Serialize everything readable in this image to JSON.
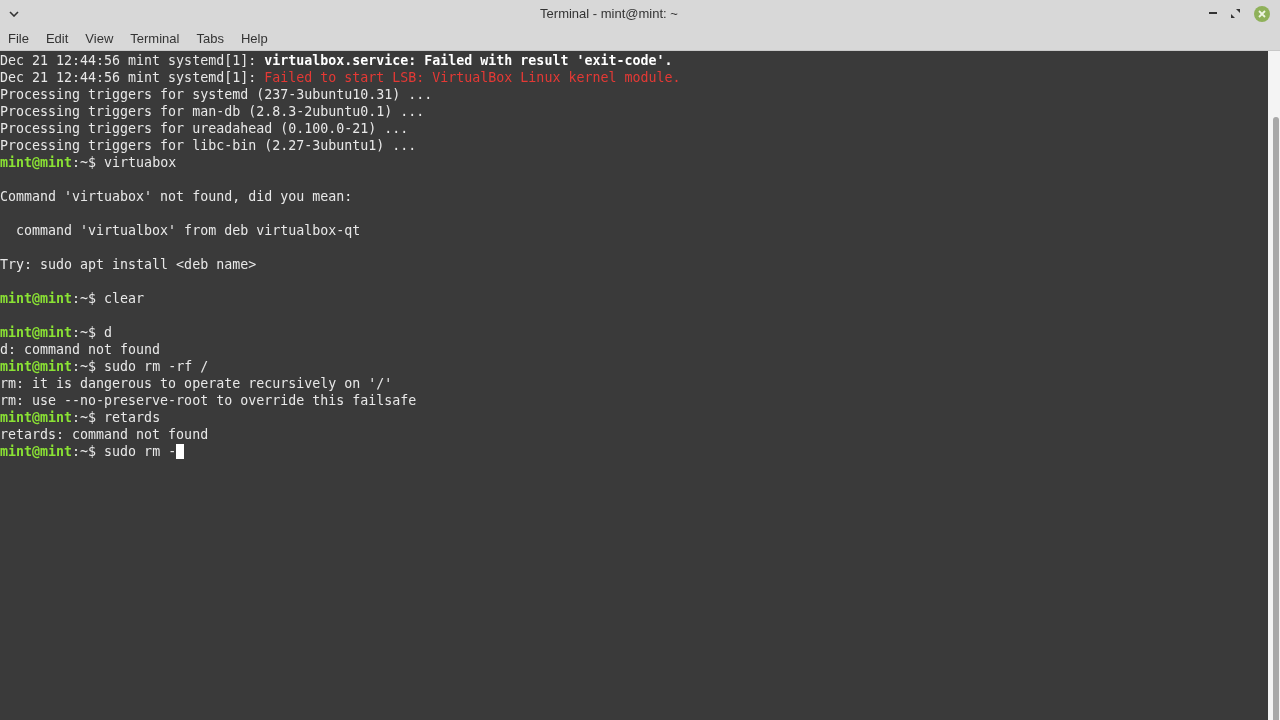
{
  "window": {
    "title": "Terminal - mint@mint: ~"
  },
  "menu": [
    "File",
    "Edit",
    "View",
    "Terminal",
    "Tabs",
    "Help"
  ],
  "lines": [
    {
      "kind": "notice",
      "prefix": "Dec 21 12:44:56 mint systemd[1]: ",
      "message": "virtualbox.service: Failed with result 'exit-code'."
    },
    {
      "kind": "error",
      "prefix": "Dec 21 12:44:56 mint systemd[1]: ",
      "message": "Failed to start LSB: VirtualBox Linux kernel module."
    },
    {
      "kind": "output",
      "text": "Processing triggers for systemd (237-3ubuntu10.31) ..."
    },
    {
      "kind": "output",
      "text": "Processing triggers for man-db (2.8.3-2ubuntu0.1) ..."
    },
    {
      "kind": "output",
      "text": "Processing triggers for ureadahead (0.100.0-21) ..."
    },
    {
      "kind": "output",
      "text": "Processing triggers for libc-bin (2.27-3ubuntu1) ..."
    },
    {
      "kind": "prompt",
      "user": "mint@mint",
      "path": ":~$",
      "command": "virtuabox"
    },
    {
      "kind": "blank"
    },
    {
      "kind": "output",
      "text": "Command 'virtuabox' not found, did you mean:"
    },
    {
      "kind": "blank"
    },
    {
      "kind": "output",
      "text": "  command 'virtualbox' from deb virtualbox-qt"
    },
    {
      "kind": "blank"
    },
    {
      "kind": "output",
      "text": "Try: sudo apt install <deb name>"
    },
    {
      "kind": "blank"
    },
    {
      "kind": "prompt",
      "user": "mint@mint",
      "path": ":~$",
      "command": "clear"
    },
    {
      "kind": "blank"
    },
    {
      "kind": "prompt",
      "user": "mint@mint",
      "path": ":~$",
      "command": "d"
    },
    {
      "kind": "output",
      "text": "d: command not found"
    },
    {
      "kind": "prompt",
      "user": "mint@mint",
      "path": ":~$",
      "command": "sudo rm -rf /"
    },
    {
      "kind": "output",
      "text": "rm: it is dangerous to operate recursively on '/'"
    },
    {
      "kind": "output",
      "text": "rm: use --no-preserve-root to override this failsafe"
    },
    {
      "kind": "prompt",
      "user": "mint@mint",
      "path": ":~$",
      "command": "retards"
    },
    {
      "kind": "output",
      "text": "retards: command not found"
    },
    {
      "kind": "prompt",
      "user": "mint@mint",
      "path": ":~$",
      "command": "sudo rm -",
      "cursor": true
    }
  ]
}
